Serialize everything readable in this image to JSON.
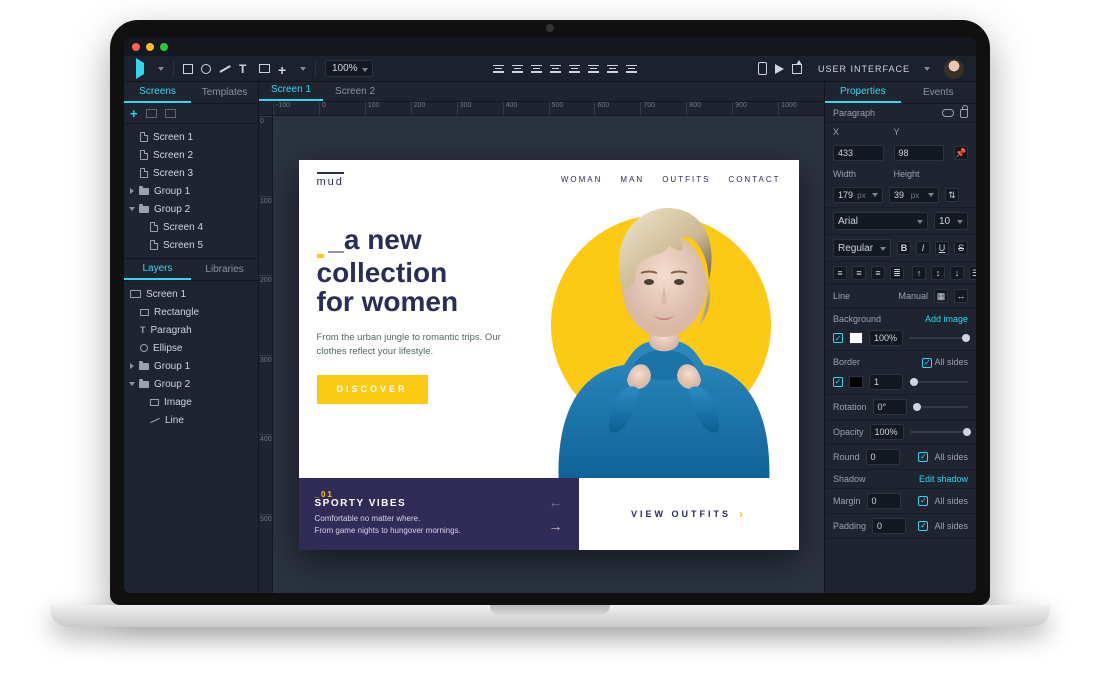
{
  "toolbar": {
    "zoom": "100%",
    "userLabel": "USER INTERFACE"
  },
  "leftPanel": {
    "tabs": [
      "Screens",
      "Templates"
    ],
    "screens": {
      "items": [
        {
          "label": "Screen 1"
        },
        {
          "label": "Screen 2"
        },
        {
          "label": "Screen 3"
        },
        {
          "label": "Group 1"
        },
        {
          "label": "Group 2"
        },
        {
          "label": "Screen 4"
        },
        {
          "label": "Screen 5"
        }
      ]
    },
    "tabs2": [
      "Layers",
      "Libraries"
    ],
    "layers": {
      "screen": "Screen 1",
      "items": [
        {
          "label": "Rectangle"
        },
        {
          "label": "Paragrah"
        },
        {
          "label": "Ellipse"
        },
        {
          "label": "Group 1"
        },
        {
          "label": "Group 2"
        },
        {
          "label": "Image"
        },
        {
          "label": "Line"
        }
      ]
    }
  },
  "docTabs": [
    "Screen 1",
    "Screen 2"
  ],
  "rulerH": [
    "-100",
    "0",
    "100",
    "200",
    "300",
    "400",
    "500",
    "600",
    "700",
    "800",
    "900",
    "1000"
  ],
  "rulerV": [
    "0",
    "100",
    "200",
    "300",
    "400",
    "500"
  ],
  "artboard": {
    "logo": "mud",
    "nav": [
      "WOMAN",
      "MAN",
      "OUTFITS",
      "CONTACT"
    ],
    "headline1": "_a new",
    "headline2": "collection",
    "headline3": "for women",
    "sub": "From the urban jungle to romantic trips. Our clothes reflect your lifestyle.",
    "cta": "DISCOVER",
    "slotNum": "_01",
    "slotTitle": "SPORTY VIBES",
    "slotDesc1": "Comfortable no matter where.",
    "slotDesc2": "From game nights to hungover mornings.",
    "viewOutfits": "VIEW OUTFITS"
  },
  "inspector": {
    "tabs": [
      "Properties",
      "Events"
    ],
    "elementLabel": "Paragraph",
    "x": {
      "label": "X",
      "value": "433"
    },
    "y": {
      "label": "Y",
      "value": "98"
    },
    "w": {
      "label": "Width",
      "value": "179",
      "unit": "px"
    },
    "h": {
      "label": "Height",
      "value": "39",
      "unit": "px"
    },
    "font": "Arial",
    "fontSize": "10",
    "weight": "Regular",
    "lineLabel": "Line",
    "lineMode": "Manual",
    "bg": {
      "label": "Background",
      "addImage": "Add image",
      "opacity": "100%"
    },
    "border": {
      "label": "Border",
      "allSides": "All sides",
      "size": "1"
    },
    "rotation": {
      "label": "Rotation",
      "value": "0°"
    },
    "opacity": {
      "label": "Opacity",
      "value": "100%"
    },
    "round": {
      "label": "Round",
      "value": "0",
      "allSides": "All sides"
    },
    "shadow": {
      "label": "Shadow",
      "edit": "Edit shadow"
    },
    "margin": {
      "label": "Margin",
      "value": "0",
      "allSides": "All sides"
    },
    "padding": {
      "label": "Padding",
      "value": "0",
      "allSides": "All sides"
    }
  }
}
